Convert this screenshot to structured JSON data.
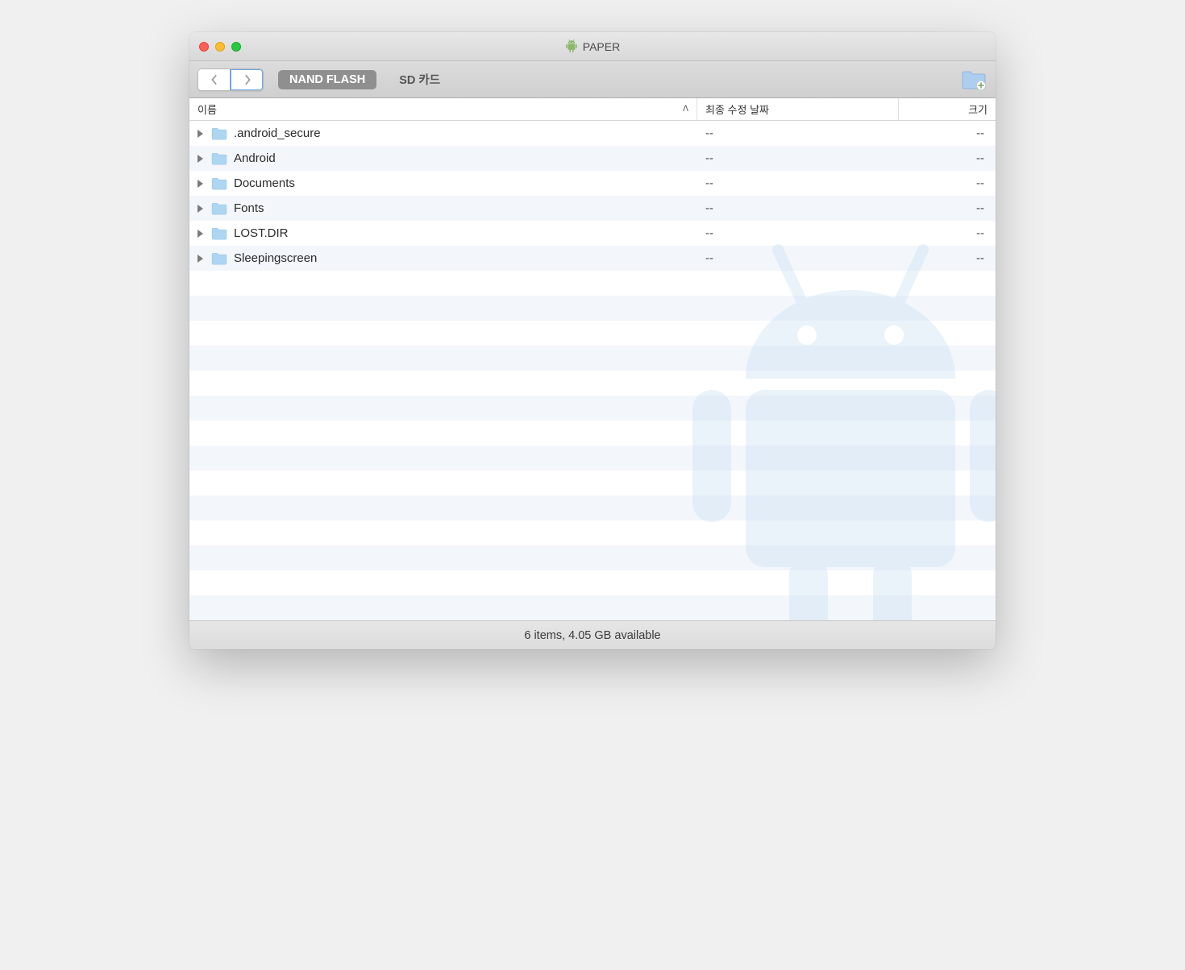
{
  "window": {
    "title": "PAPER"
  },
  "toolbar": {
    "tabs": [
      {
        "label": "NAND FLASH",
        "active": true
      },
      {
        "label": "SD 카드",
        "active": false
      }
    ]
  },
  "columns": {
    "name": "이름",
    "date": "최종 수정 날짜",
    "size": "크기"
  },
  "files": [
    {
      "name": ".android_secure",
      "date": "--",
      "size": "--"
    },
    {
      "name": "Android",
      "date": "--",
      "size": "--"
    },
    {
      "name": "Documents",
      "date": "--",
      "size": "--"
    },
    {
      "name": "Fonts",
      "date": "--",
      "size": "--"
    },
    {
      "name": "LOST.DIR",
      "date": "--",
      "size": "--"
    },
    {
      "name": "Sleepingscreen",
      "date": "--",
      "size": "--"
    }
  ],
  "status": "6 items, 4.05 GB available"
}
